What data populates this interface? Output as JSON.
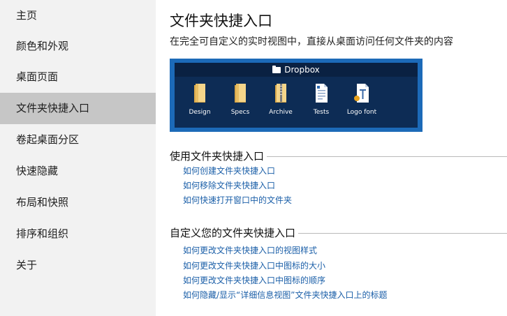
{
  "sidebar": {
    "items": [
      {
        "label": "主页",
        "active": false
      },
      {
        "label": "颜色和外观",
        "active": false
      },
      {
        "label": "桌面页面",
        "active": false
      },
      {
        "label": "文件夹快捷入口",
        "active": true
      },
      {
        "label": "卷起桌面分区",
        "active": false
      },
      {
        "label": "快速隐藏",
        "active": false
      },
      {
        "label": "布局和快照",
        "active": false
      },
      {
        "label": "排序和组织",
        "active": false
      },
      {
        "label": "关于",
        "active": false
      }
    ]
  },
  "main": {
    "title": "文件夹快捷入口",
    "subtitle": "在完全可自定义的实时视图中，直接从桌面访问任何文件夹的内容",
    "preview": {
      "folder_name": "Dropbox",
      "tiles": [
        {
          "label": "Design",
          "icon": "folder-icon"
        },
        {
          "label": "Specs",
          "icon": "folder-icon"
        },
        {
          "label": "Archive",
          "icon": "zip-folder-icon"
        },
        {
          "label": "Tests",
          "icon": "document-icon"
        },
        {
          "label": "Logo font",
          "icon": "font-file-icon"
        }
      ],
      "colors": {
        "frame": "#1c6ab8",
        "panel": "#0d2c55",
        "titlebar": "#0a2142"
      }
    },
    "sections": [
      {
        "heading": "使用文件夹快捷入口",
        "links": [
          "如何创建文件夹快捷入口",
          "如何移除文件夹快捷入口",
          "如何快速打开窗口中的文件夹"
        ]
      },
      {
        "heading": "自定义您的文件夹快捷入口",
        "links": [
          "如何更改文件夹快捷入口的视图样式",
          "如何更改文件夹快捷入口中图标的大小",
          "如何更改文件夹快捷入口中图标的顺序",
          "如何隐藏/显示“详细信息视图”文件夹快捷入口上的标题"
        ]
      }
    ],
    "link_color": "#1b5fa8"
  }
}
